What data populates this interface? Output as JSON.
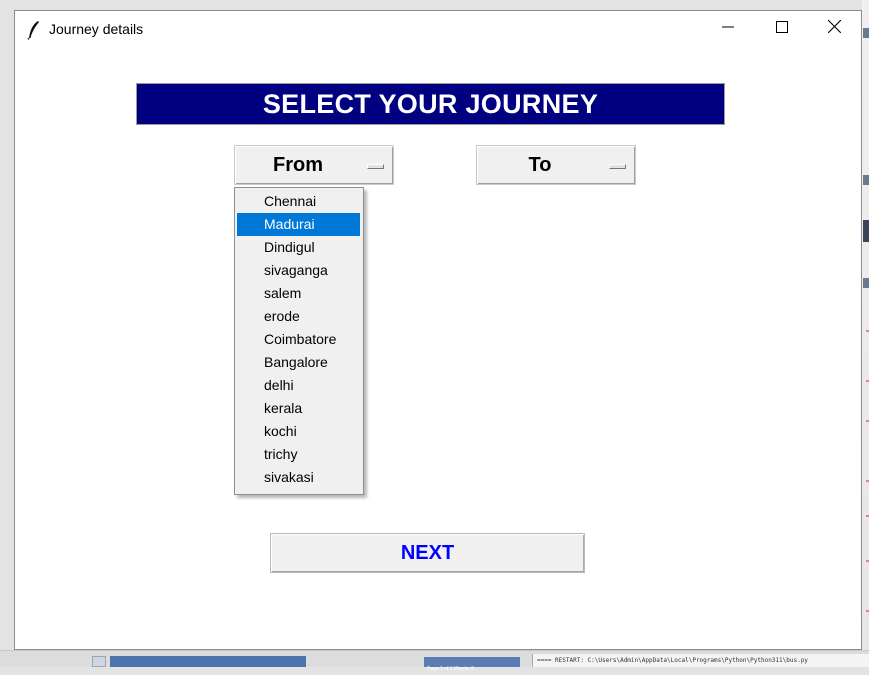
{
  "window": {
    "title": "Journey details"
  },
  "header": {
    "title": "SELECT YOUR JOURNEY",
    "background": "#000080",
    "color": "#ffffff"
  },
  "from_menu": {
    "label": "From"
  },
  "to_menu": {
    "label": "To"
  },
  "dropdown": {
    "selected": "Madurai",
    "highlight_color": "#0078d7",
    "items": [
      "Chennai",
      "Madurai",
      "Dindigul",
      "sivaganga",
      "salem",
      "erode",
      "Coimbatore",
      "Bangalore",
      "delhi",
      "kerala",
      "kochi",
      "trichy",
      "sivakasi"
    ]
  },
  "next_button": {
    "label": "NEXT",
    "color": "#0000ff"
  },
  "background_apps": {
    "status_bar_text": "Page 1 of 1   Words: 0",
    "shell_text": "==== RESTART: C:\\Users\\Admin\\AppData\\Local\\Programs\\Python\\Python311\\bus.py"
  },
  "icons": {
    "app": "feather-icon",
    "minimize": "minimize-icon",
    "maximize": "maximize-icon",
    "close": "close-icon"
  }
}
